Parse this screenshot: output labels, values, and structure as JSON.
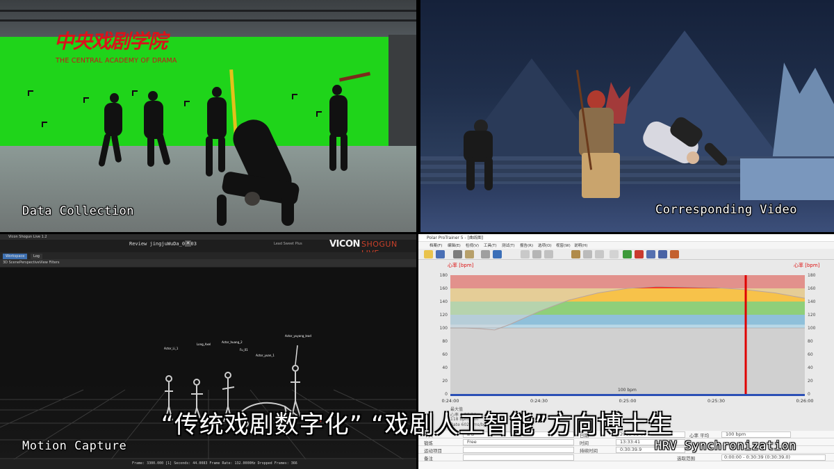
{
  "panels": {
    "data_collection": {
      "caption": "Data Collection",
      "logo_text": "中央戏剧学院",
      "logo_subtitle": "THE CENTRAL ACADEMY OF DRAMA"
    },
    "corresponding_video": {
      "caption": "Corresponding Video"
    },
    "motion_capture": {
      "caption": "Motion Capture",
      "window_title": "Vicon Shogun Live 1.2",
      "review_title": "Review jingjuWuDa_01_03",
      "lead_label": "Lead Sweet Plus",
      "brand_vicon": "VICON",
      "brand_shogun": "SHOGUN LIVE",
      "tabs": [
        "Workspace",
        "Log"
      ],
      "toolbar": [
        "3D Scene",
        "Perspective",
        "View Filters"
      ],
      "actor_labels": [
        "Actor_Li_1",
        "Long_Axel",
        "Actor_huang_2",
        "Fu_01",
        "Actor_yuan_1",
        "Actor_yuyang_lead"
      ],
      "status": "Frame: 3300.000 [1]   Seconds: 44.0083   Frame Rate: 132.0000Hz   Dropped Frames: 366"
    },
    "hrv_sync": {
      "caption": "HRV Synchronization",
      "window_title": "Polar ProTrainer 5 - [曲线图]",
      "menu": [
        "档案(F)",
        "编辑(E)",
        "检视(V)",
        "工具(T)",
        "测试(T)",
        "报告(R)",
        "选项(O)",
        "视窗(W)",
        "说明(H)"
      ],
      "y_axis_title": "心率 [bpm]",
      "y_axis_title_right": "心率 [bpm]",
      "marker_label": "100 bpm",
      "info_lines": [
        "最大值",
        "心率 0:26:24",
        "118 bpm/min",
        "Rate 6024 ms/bpm"
      ],
      "table": {
        "rows": [
          {
            "label": "个人",
            "value": "a b",
            "label2": "日期",
            "value2": "2018-01-09",
            "label3": "心率 平均",
            "value3": "100 bpm"
          },
          {
            "label": "锻炼",
            "value": "Free",
            "label2": "时间",
            "value2": "13:33:41",
            "label3": "",
            "value3": ""
          },
          {
            "label": "运动项目",
            "value": "",
            "label2": "持续时间",
            "value2": "0:30:39.9",
            "label3": "",
            "value3": ""
          },
          {
            "label": "备注",
            "value": "",
            "label2": "",
            "value2": "",
            "label3": "选取范围",
            "value3": "0:00:00 - 0:30:39 (0:30:39.0)"
          }
        ]
      }
    }
  },
  "chart_data": {
    "type": "area",
    "ylabel": "心率 [bpm]",
    "ylim": [
      0,
      180
    ],
    "y_ticks": [
      0,
      20,
      40,
      60,
      80,
      100,
      120,
      140,
      160,
      180
    ],
    "x_ticks": [
      "0:24:00",
      "0:24:30",
      "0:25:00",
      "0:25:30",
      "0:26:00"
    ],
    "zones": [
      {
        "from": 90,
        "to": 105,
        "color": "#b8d8e8"
      },
      {
        "from": 105,
        "to": 120,
        "color": "#8fc0da"
      },
      {
        "from": 120,
        "to": 140,
        "color": "#8fcf7a"
      },
      {
        "from": 140,
        "to": 160,
        "color": "#f7c24a"
      },
      {
        "from": 160,
        "to": 180,
        "color": "#ef3b30"
      }
    ],
    "series": [
      {
        "x": [
          "0:24:00",
          "0:24:05",
          "0:24:10",
          "0:24:15",
          "0:24:20",
          "0:24:30",
          "0:24:40",
          "0:24:50",
          "0:25:00",
          "0:25:10",
          "0:25:20",
          "0:25:30",
          "0:25:40",
          "0:25:50",
          "0:26:00"
        ],
        "values": [
          100,
          100,
          99,
          97,
          105,
          125,
          142,
          153,
          160,
          163,
          162,
          161,
          158,
          153,
          145
        ]
      }
    ],
    "marker_time": "0:25:40",
    "baseline": 100
  },
  "subtitle": "“传统戏剧数字化” “戏剧人工智能”方向博士生"
}
